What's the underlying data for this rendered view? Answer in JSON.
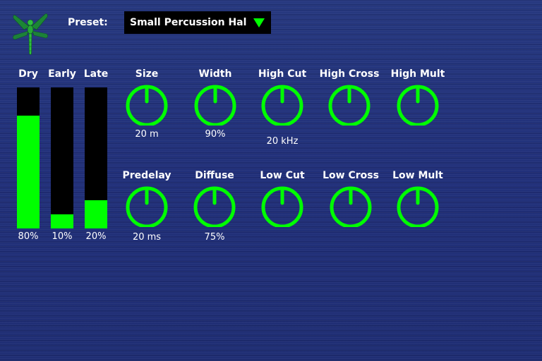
{
  "colors": {
    "accent": "#00ff00",
    "background": "#22327a",
    "control_bg": "#000000",
    "text": "#ffffff"
  },
  "logo": {
    "icon": "dragonfly-icon"
  },
  "preset": {
    "label": "Preset:",
    "selected": "Small Percussion Hall",
    "icon": "triangle-down-icon"
  },
  "meters": [
    {
      "label": "Dry",
      "value": "80%",
      "level": 0.8
    },
    {
      "label": "Early",
      "value": "10%",
      "level": 0.1
    },
    {
      "label": "Late",
      "value": "20%",
      "level": 0.2
    }
  ],
  "knobs": [
    {
      "label": "Size",
      "value": "20 m"
    },
    {
      "label": "Width",
      "value": "90%"
    },
    {
      "label": "High Cut",
      "value": "20 kHz"
    },
    {
      "label": "High Cross",
      "value": ""
    },
    {
      "label": "High Mult",
      "value": ""
    },
    {
      "label": "Predelay",
      "value": "20 ms"
    },
    {
      "label": "Diffuse",
      "value": "75%"
    },
    {
      "label": "Low Cut",
      "value": ""
    },
    {
      "label": "Low Cross",
      "value": ""
    },
    {
      "label": "Low Mult",
      "value": ""
    }
  ]
}
